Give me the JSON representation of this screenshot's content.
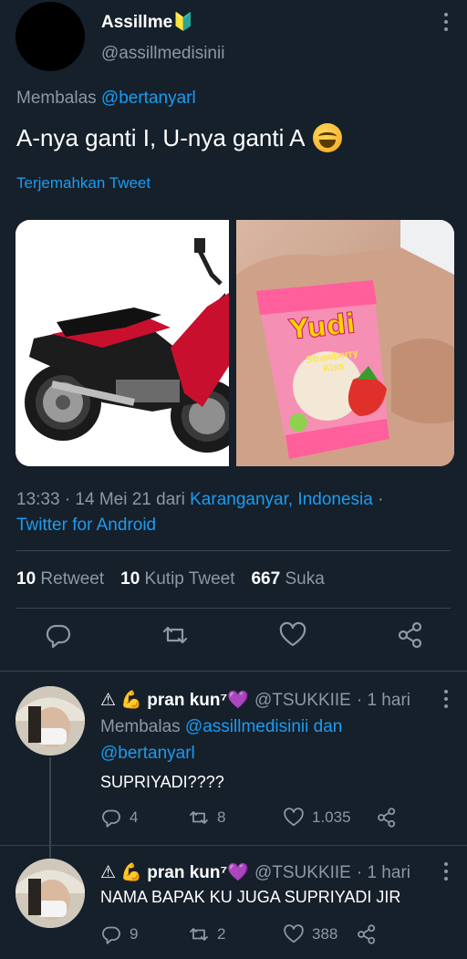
{
  "tweet": {
    "author_name": "Assillme🔰",
    "author_handle": "@assillmedisinii",
    "replying_prefix": "Membalas ",
    "replying_to": "@bertanyarl",
    "text": "A-nya ganti I, U-nya ganti A",
    "emoji": "grinning-squinting-face",
    "translate_label": "Terjemahkan Tweet",
    "time_date": "13:33 · 14 Mei 21 dari ",
    "location": "Karanganyar, Indonesia",
    "sep": " ·",
    "client": "Twitter for Android",
    "stats": {
      "retweets_count": "10",
      "retweets_label": "Retweet",
      "quotes_count": "10",
      "quotes_label": "Kutip Tweet",
      "likes_count": "667",
      "likes_label": "Suka"
    },
    "media": [
      {
        "name": "motorcycle-photo"
      },
      {
        "name": "candy-photo",
        "brand_text": "Yudi",
        "flavor_text": "Strawberry Kiss"
      }
    ]
  },
  "replies": [
    {
      "name": "⚠ 💪 pran kun⁷💜",
      "handle": "@TSUKKIIE",
      "time": "· 1 hari",
      "replying_prefix": "Membalas ",
      "replying_to_1": "@assillmedisinii",
      "replying_and": " dan",
      "replying_to_2": "@bertanyarl",
      "text": "SUPRIYADI????",
      "replies_count": "4",
      "retweets_count": "8",
      "likes_count": "1.035"
    },
    {
      "name": "⚠ 💪 pran kun⁷💜",
      "handle": "@TSUKKIIE",
      "time": "· 1 hari",
      "text": "NAMA BAPAK KU JUGA SUPRIYADI JIR",
      "replies_count": "9",
      "retweets_count": "2",
      "likes_count": "388"
    }
  ],
  "colors": {
    "background": "#15202b",
    "accent": "#1d9bf0",
    "muted": "#8b98a5",
    "divider": "#38444d"
  }
}
